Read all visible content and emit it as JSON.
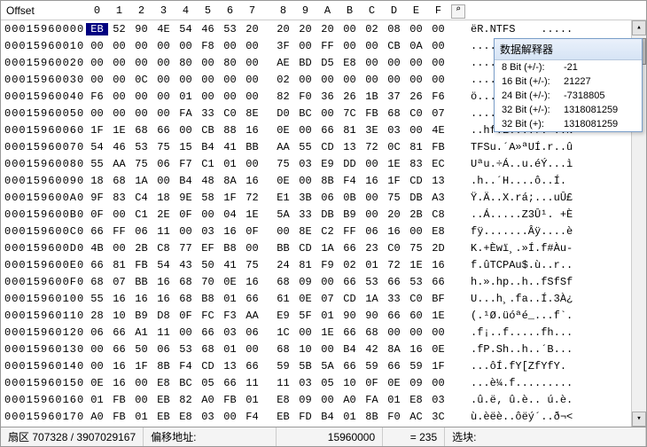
{
  "header": {
    "offset_label": "Offset",
    "cols": [
      "0",
      "1",
      "2",
      "3",
      "4",
      "5",
      "6",
      "7",
      "8",
      "9",
      "A",
      "B",
      "C",
      "D",
      "E",
      "F"
    ],
    "tool_icon": "⌕"
  },
  "interpreter": {
    "title": "数据解释器",
    "rows": [
      {
        "label": "8 Bit (+/-):",
        "value": "-21"
      },
      {
        "label": "16 Bit (+/-):",
        "value": "21227"
      },
      {
        "label": "24 Bit (+/-):",
        "value": "-7318805"
      },
      {
        "label": "32 Bit (+/-):",
        "value": "1318081259"
      },
      {
        "label": "32 Bit (+):",
        "value": "1318081259"
      }
    ]
  },
  "rows": [
    {
      "offset": "00015960000",
      "hex": [
        "EB",
        "52",
        "90",
        "4E",
        "54",
        "46",
        "53",
        "20",
        "20",
        "20",
        "20",
        "00",
        "02",
        "08",
        "00",
        "00"
      ],
      "ascii": "ëR.NTFS    .....",
      "sel": 0
    },
    {
      "offset": "00015960010",
      "hex": [
        "00",
        "00",
        "00",
        "00",
        "00",
        "F8",
        "00",
        "00",
        "3F",
        "00",
        "FF",
        "00",
        "00",
        "CB",
        "0A",
        "00"
      ],
      "ascii": "....ø..?.ÿ..Ë.."
    },
    {
      "offset": "00015960020",
      "hex": [
        "00",
        "00",
        "00",
        "00",
        "80",
        "00",
        "80",
        "00",
        "AE",
        "BD",
        "D5",
        "E8",
        "00",
        "00",
        "00",
        "00"
      ],
      "ascii": "....€.€.®½Õè...."
    },
    {
      "offset": "00015960030",
      "hex": [
        "00",
        "00",
        "0C",
        "00",
        "00",
        "00",
        "00",
        "00",
        "02",
        "00",
        "00",
        "00",
        "00",
        "00",
        "00",
        "00"
      ],
      "ascii": "................"
    },
    {
      "offset": "00015960040",
      "hex": [
        "F6",
        "00",
        "00",
        "00",
        "01",
        "00",
        "00",
        "00",
        "82",
        "F0",
        "36",
        "26",
        "1B",
        "37",
        "26",
        "F6"
      ],
      "ascii": "ö.......‚ð6&.7&ö"
    },
    {
      "offset": "00015960050",
      "hex": [
        "00",
        "00",
        "00",
        "00",
        "FA",
        "33",
        "C0",
        "8E",
        "D0",
        "BC",
        "00",
        "7C",
        "FB",
        "68",
        "C0",
        "07"
      ],
      "ascii": "....ú3À.Ð¼.|ûhÀ."
    },
    {
      "offset": "00015960060",
      "hex": [
        "1F",
        "1E",
        "68",
        "66",
        "00",
        "CB",
        "88",
        "16",
        "0E",
        "00",
        "66",
        "81",
        "3E",
        "03",
        "00",
        "4E"
      ],
      "ascii": "..hf.Ë....f.>..N"
    },
    {
      "offset": "00015960070",
      "hex": [
        "54",
        "46",
        "53",
        "75",
        "15",
        "B4",
        "41",
        "BB",
        "AA",
        "55",
        "CD",
        "13",
        "72",
        "0C",
        "81",
        "FB"
      ],
      "ascii": "TFSu.´A»ªUÍ.r..û"
    },
    {
      "offset": "00015960080",
      "hex": [
        "55",
        "AA",
        "75",
        "06",
        "F7",
        "C1",
        "01",
        "00",
        "75",
        "03",
        "E9",
        "DD",
        "00",
        "1E",
        "83",
        "EC"
      ],
      "ascii": "Uªu.÷Á..u.éÝ...ì"
    },
    {
      "offset": "00015960090",
      "hex": [
        "18",
        "68",
        "1A",
        "00",
        "B4",
        "48",
        "8A",
        "16",
        "0E",
        "00",
        "8B",
        "F4",
        "16",
        "1F",
        "CD",
        "13"
      ],
      "ascii": ".h..´H....ô..Í."
    },
    {
      "offset": "000159600A0",
      "hex": [
        "9F",
        "83",
        "C4",
        "18",
        "9E",
        "58",
        "1F",
        "72",
        "E1",
        "3B",
        "06",
        "0B",
        "00",
        "75",
        "DB",
        "A3"
      ],
      "ascii": "Ÿ.Ä..X.rá;...uÛ£"
    },
    {
      "offset": "000159600B0",
      "hex": [
        "0F",
        "00",
        "C1",
        "2E",
        "0F",
        "00",
        "04",
        "1E",
        "5A",
        "33",
        "DB",
        "B9",
        "00",
        "20",
        "2B",
        "C8"
      ],
      "ascii": "..Á.....Z3Û¹. +È"
    },
    {
      "offset": "000159600C0",
      "hex": [
        "66",
        "FF",
        "06",
        "11",
        "00",
        "03",
        "16",
        "0F",
        "00",
        "8E",
        "C2",
        "FF",
        "06",
        "16",
        "00",
        "E8"
      ],
      "ascii": "fÿ.......Âÿ....è"
    },
    {
      "offset": "000159600D0",
      "hex": [
        "4B",
        "00",
        "2B",
        "C8",
        "77",
        "EF",
        "B8",
        "00",
        "BB",
        "CD",
        "1A",
        "66",
        "23",
        "C0",
        "75",
        "2D"
      ],
      "ascii": "K.+Èwï¸.»Í.f#Àu-"
    },
    {
      "offset": "000159600E0",
      "hex": [
        "66",
        "81",
        "FB",
        "54",
        "43",
        "50",
        "41",
        "75",
        "24",
        "81",
        "F9",
        "02",
        "01",
        "72",
        "1E",
        "16"
      ],
      "ascii": "f.ûTCPAu$.ù..r.."
    },
    {
      "offset": "000159600F0",
      "hex": [
        "68",
        "07",
        "BB",
        "16",
        "68",
        "70",
        "0E",
        "16",
        "68",
        "09",
        "00",
        "66",
        "53",
        "66",
        "53",
        "66"
      ],
      "ascii": "h.».hp..h..fSfSf"
    },
    {
      "offset": "00015960100",
      "hex": [
        "55",
        "16",
        "16",
        "16",
        "68",
        "B8",
        "01",
        "66",
        "61",
        "0E",
        "07",
        "CD",
        "1A",
        "33",
        "C0",
        "BF"
      ],
      "ascii": "U...h¸.fa..Í.3À¿"
    },
    {
      "offset": "00015960110",
      "hex": [
        "28",
        "10",
        "B9",
        "D8",
        "0F",
        "FC",
        "F3",
        "AA",
        "E9",
        "5F",
        "01",
        "90",
        "90",
        "66",
        "60",
        "1E"
      ],
      "ascii": "(.¹Ø.üóªé_...f`."
    },
    {
      "offset": "00015960120",
      "hex": [
        "06",
        "66",
        "A1",
        "11",
        "00",
        "66",
        "03",
        "06",
        "1C",
        "00",
        "1E",
        "66",
        "68",
        "00",
        "00",
        "00"
      ],
      "ascii": ".f¡..f.....fh..."
    },
    {
      "offset": "00015960130",
      "hex": [
        "00",
        "66",
        "50",
        "06",
        "53",
        "68",
        "01",
        "00",
        "68",
        "10",
        "00",
        "B4",
        "42",
        "8A",
        "16",
        "0E"
      ],
      "ascii": ".fP.Sh..h..´B..."
    },
    {
      "offset": "00015960140",
      "hex": [
        "00",
        "16",
        "1F",
        "8B",
        "F4",
        "CD",
        "13",
        "66",
        "59",
        "5B",
        "5A",
        "66",
        "59",
        "66",
        "59",
        "1F"
      ],
      "ascii": "...ôÍ.fY[ZfYfY."
    },
    {
      "offset": "00015960150",
      "hex": [
        "0E",
        "16",
        "00",
        "E8",
        "BC",
        "05",
        "66",
        "11",
        "11",
        "03",
        "05",
        "10",
        "0F",
        "0E",
        "09",
        "00"
      ],
      "ascii": "...è¼.f........."
    },
    {
      "offset": "00015960160",
      "hex": [
        "01",
        "FB",
        "00",
        "EB",
        "82",
        "A0",
        "FB",
        "01",
        "E8",
        "09",
        "00",
        "A0",
        "FA",
        "01",
        "E8",
        "03"
      ],
      "ascii": ".û.ë‚ û.è.. ú.è."
    },
    {
      "offset": "00015960170",
      "hex": [
        "A0",
        "FB",
        "01",
        "EB",
        "E8",
        "03",
        "00",
        "F4",
        "EB",
        "FD",
        "B4",
        "01",
        "8B",
        "F0",
        "AC",
        "3C"
      ],
      "ascii": "ù.èëè..ôëý´..ð¬<"
    }
  ],
  "statusbar": {
    "sector_label": "扇区",
    "sector_value": "707328 / 3907029167",
    "offset_label": "偏移地址:",
    "offset_value": "15960000",
    "eq_label": "= 235",
    "sel_label": "选块:"
  }
}
